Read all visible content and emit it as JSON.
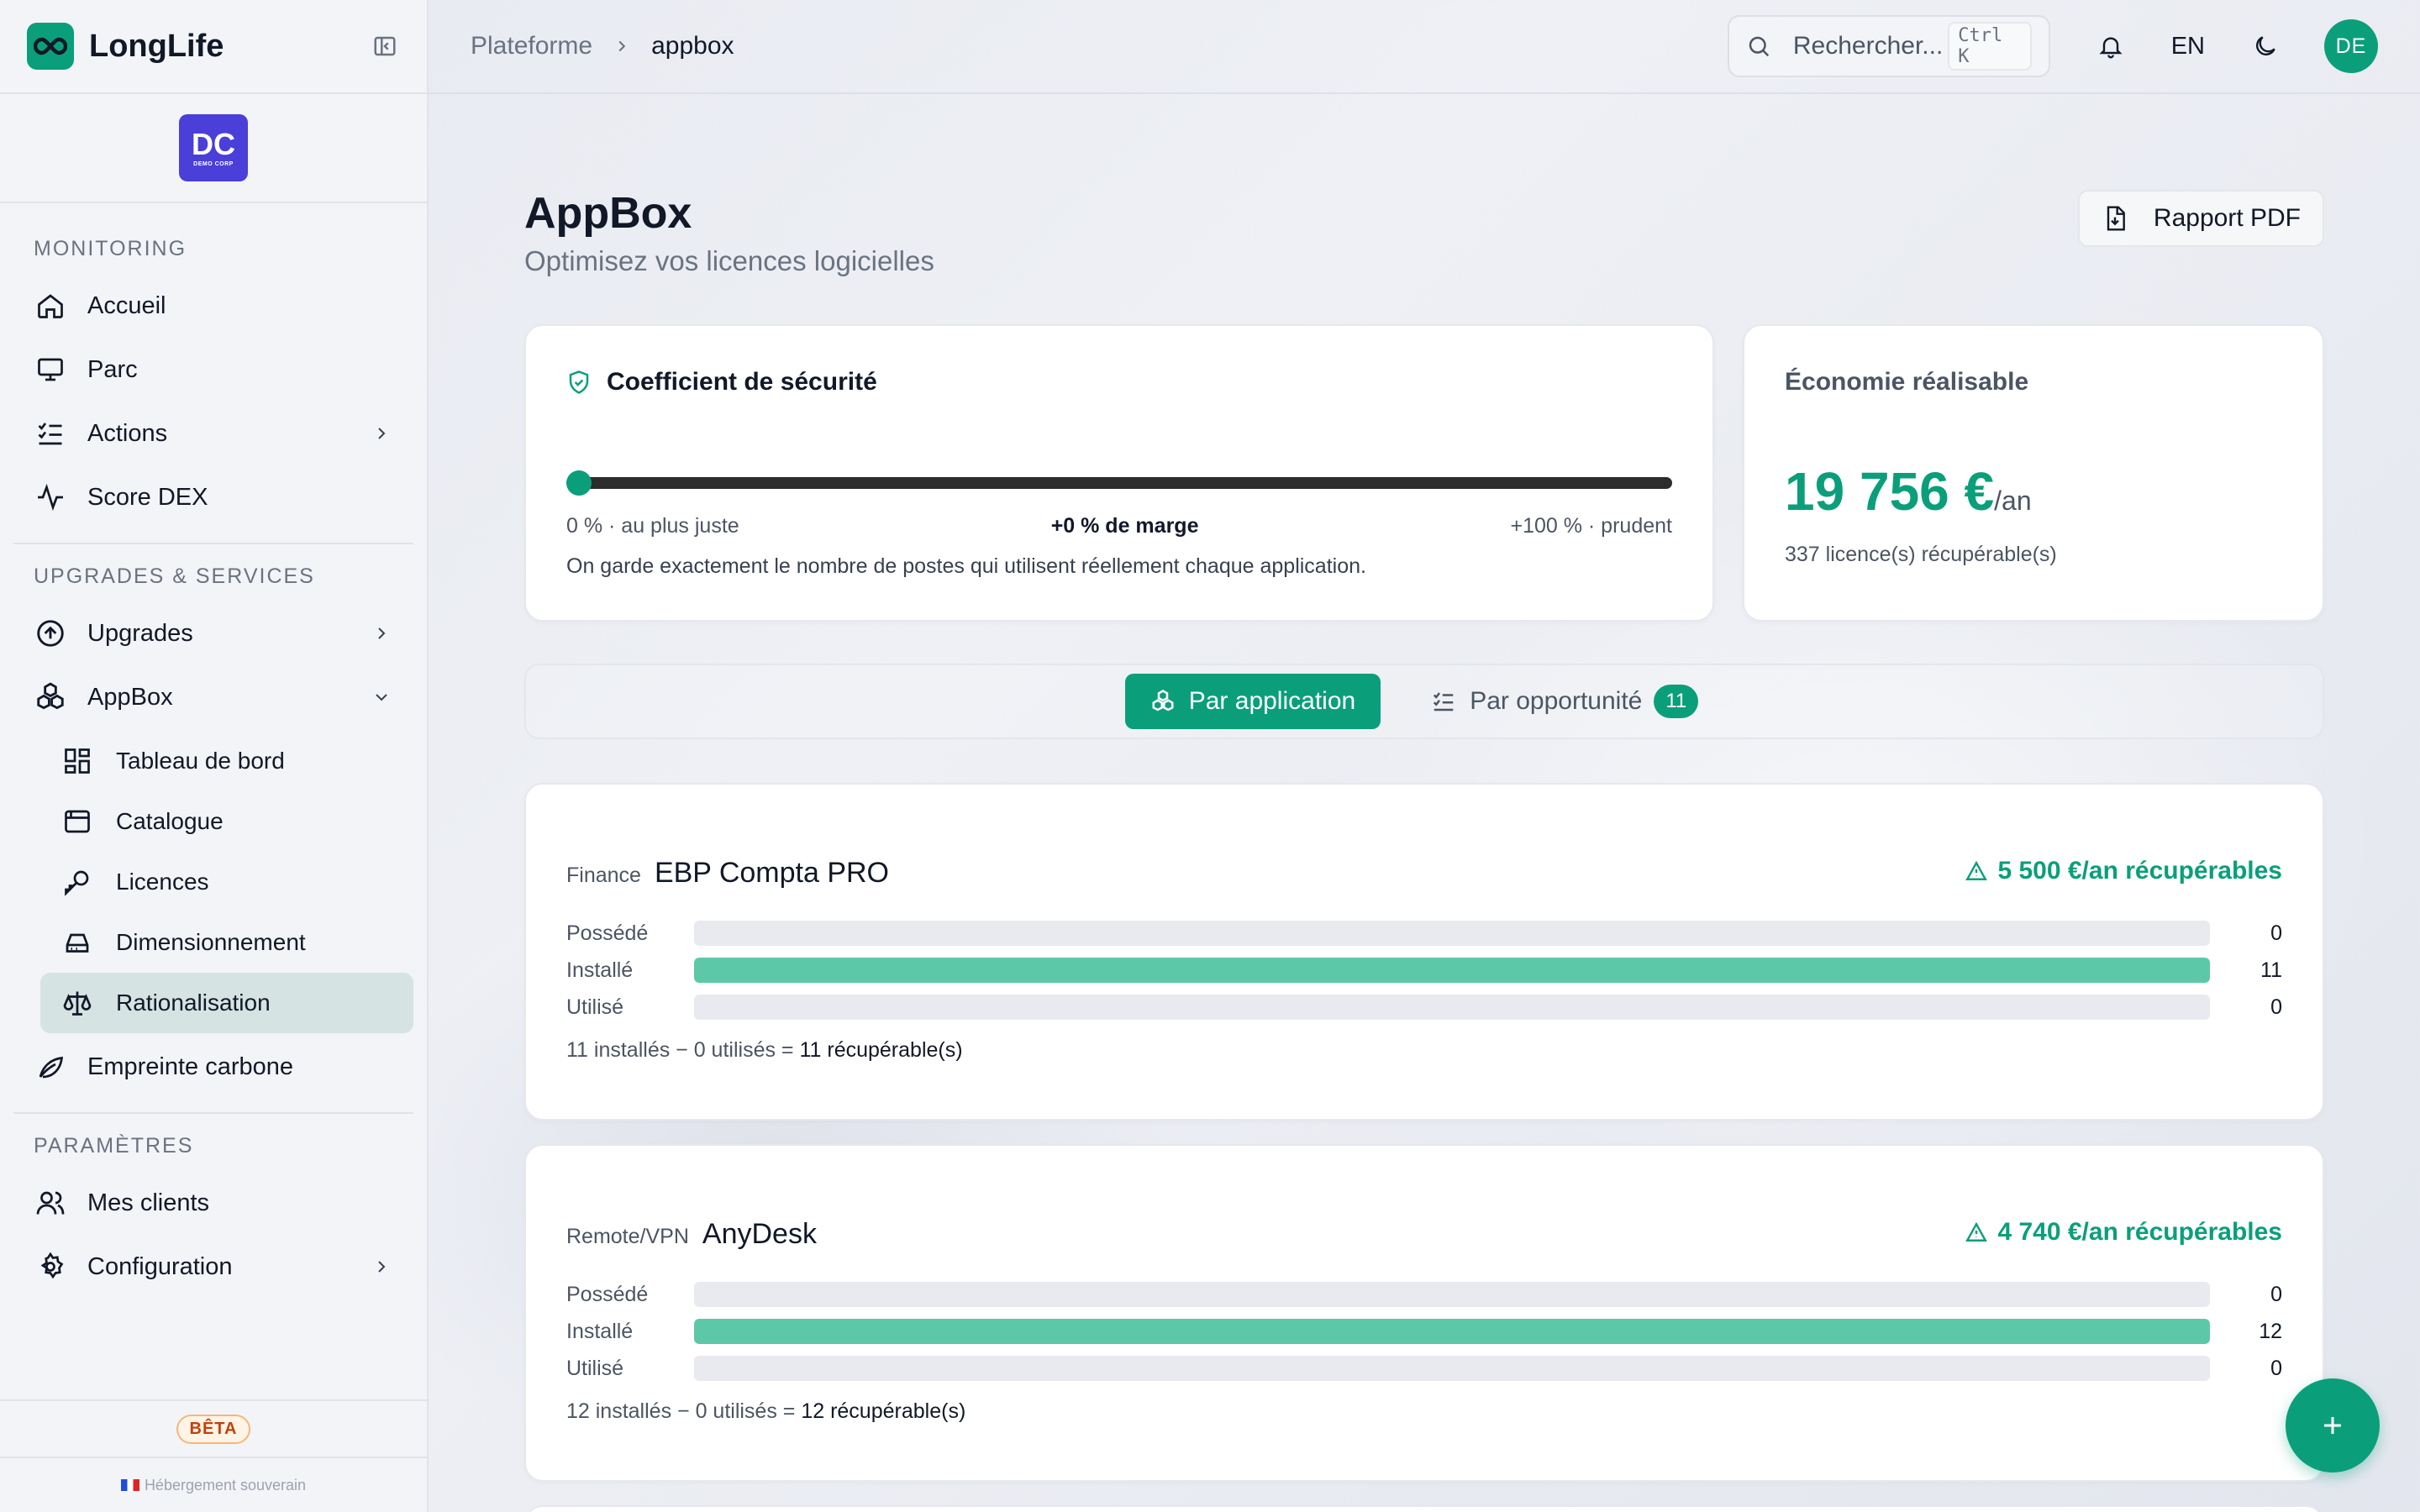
{
  "brand": {
    "name": "LongLife"
  },
  "org": {
    "initials": "DC",
    "caption": "DEMO CORP"
  },
  "sidebar": {
    "sections": [
      {
        "label": "MONITORING"
      },
      {
        "label": "UPGRADES & SERVICES"
      },
      {
        "label": "PARAMÈTRES"
      }
    ],
    "monitoring": [
      {
        "label": "Accueil",
        "icon": "home-icon"
      },
      {
        "label": "Parc",
        "icon": "monitor-icon"
      },
      {
        "label": "Actions",
        "icon": "list-check-icon"
      },
      {
        "label": "Score DEX",
        "icon": "activity-icon"
      }
    ],
    "upgrades": [
      {
        "label": "Upgrades",
        "icon": "arrow-up-circle-icon"
      },
      {
        "label": "AppBox",
        "icon": "boxes-icon"
      }
    ],
    "appbox_sub": [
      {
        "label": "Tableau de bord",
        "icon": "dashboard-icon"
      },
      {
        "label": "Catalogue",
        "icon": "browser-icon"
      },
      {
        "label": "Licences",
        "icon": "key-icon"
      },
      {
        "label": "Dimensionnement",
        "icon": "drive-icon"
      },
      {
        "label": "Rationalisation",
        "icon": "scale-icon"
      }
    ],
    "carbon": {
      "label": "Empreinte carbone",
      "icon": "leaf-icon"
    },
    "settings": [
      {
        "label": "Mes clients",
        "icon": "users-icon"
      },
      {
        "label": "Configuration",
        "icon": "gear-icon"
      }
    ],
    "beta": "BÊTA",
    "hosting": "Hébergement souverain"
  },
  "topbar": {
    "breadcrumb": [
      "Plateforme",
      "appbox"
    ],
    "search_placeholder": "Rechercher...",
    "shortcut": "Ctrl K",
    "language": "EN",
    "avatar": "DE"
  },
  "page": {
    "title": "AppBox",
    "subtitle": "Optimisez vos licences logicielles",
    "pdf_button": "Rapport PDF"
  },
  "security": {
    "title": "Coefficient de sécurité",
    "value_percent": 0,
    "left_label": "0 % · au plus juste",
    "mid_label": "+0 % de marge",
    "right_label": "+100 % · prudent",
    "description": "On garde exactement le nombre de postes qui utilisent réellement chaque application."
  },
  "economy": {
    "title": "Économie réalisable",
    "value": "19 756 €",
    "unit": "/an",
    "sub": "337 licence(s) récupérable(s)"
  },
  "tabs": {
    "by_app": "Par application",
    "by_opportunity": "Par opportunité",
    "opportunity_count": "11"
  },
  "apps": [
    {
      "category": "Finance",
      "name": "EBP Compta PRO",
      "recoverable": "5 500 €/an récupérables",
      "rows": [
        {
          "label": "Possédé",
          "value": "0",
          "fill": 0
        },
        {
          "label": "Installé",
          "value": "11",
          "fill": 1
        },
        {
          "label": "Utilisé",
          "value": "0",
          "fill": 0
        }
      ],
      "formula": "11 installés − 0 utilisés = ",
      "formula_result": "11 récupérable(s)"
    },
    {
      "category": "Remote/VPN",
      "name": "AnyDesk",
      "recoverable": "4 740 €/an récupérables",
      "rows": [
        {
          "label": "Possédé",
          "value": "0",
          "fill": 0
        },
        {
          "label": "Installé",
          "value": "12",
          "fill": 1
        },
        {
          "label": "Utilisé",
          "value": "0",
          "fill": 0
        }
      ],
      "formula": "12 installés − 0 utilisés = ",
      "formula_result": "12 récupérable(s)"
    }
  ],
  "fab_label": "+",
  "colors": {
    "accent": "#0a9f7a",
    "bar_fill": "#5cc8a8",
    "org_badge": "#4a3fd8"
  }
}
